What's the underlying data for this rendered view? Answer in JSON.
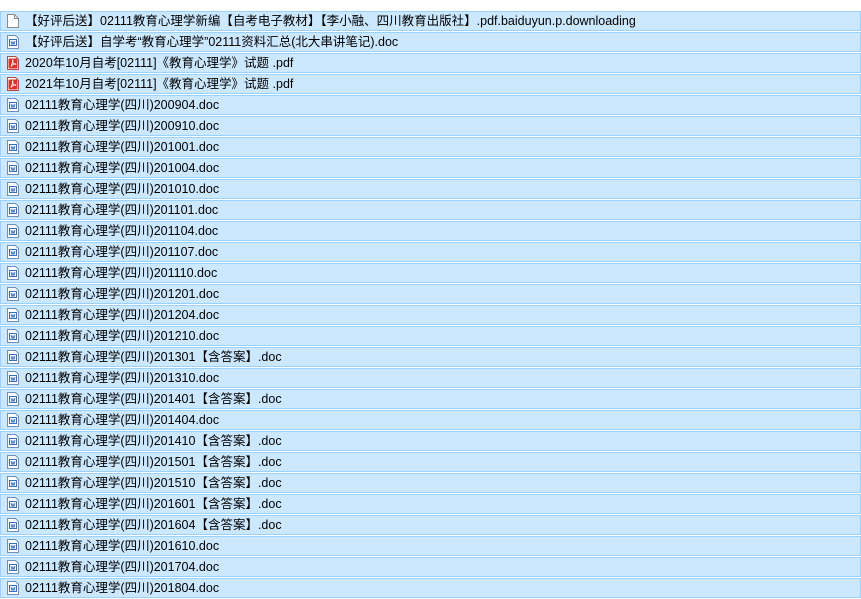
{
  "colors": {
    "selected_background": "#cce8ff",
    "selected_border": "#99d1ff",
    "pdf_icon": "#d9342b",
    "doc_icon": "#3a6fb0"
  },
  "files": [
    {
      "name": "【好评后送】02111教育心理学新编【自考电子教材】【李小融、四川教育出版社】.pdf.baiduyun.p.downloading",
      "icon": "blank-file-icon"
    },
    {
      "name": "【好评后送】自学考“教育心理学”02111资料汇总(北大串讲笔记).doc",
      "icon": "doc-file-icon"
    },
    {
      "name": "2020年10月自考[02111]《教育心理学》试题 .pdf",
      "icon": "pdf-file-icon"
    },
    {
      "name": "2021年10月自考[02111]《教育心理学》试题 .pdf",
      "icon": "pdf-file-icon"
    },
    {
      "name": "02111教育心理学(四川)200904.doc",
      "icon": "doc-file-icon"
    },
    {
      "name": "02111教育心理学(四川)200910.doc",
      "icon": "doc-file-icon"
    },
    {
      "name": "02111教育心理学(四川)201001.doc",
      "icon": "doc-file-icon"
    },
    {
      "name": "02111教育心理学(四川)201004.doc",
      "icon": "doc-file-icon"
    },
    {
      "name": "02111教育心理学(四川)201010.doc",
      "icon": "doc-file-icon"
    },
    {
      "name": "02111教育心理学(四川)201101.doc",
      "icon": "doc-file-icon"
    },
    {
      "name": "02111教育心理学(四川)201104.doc",
      "icon": "doc-file-icon"
    },
    {
      "name": "02111教育心理学(四川)201107.doc",
      "icon": "doc-file-icon"
    },
    {
      "name": "02111教育心理学(四川)201110.doc",
      "icon": "doc-file-icon"
    },
    {
      "name": "02111教育心理学(四川)201201.doc",
      "icon": "doc-file-icon"
    },
    {
      "name": "02111教育心理学(四川)201204.doc",
      "icon": "doc-file-icon"
    },
    {
      "name": "02111教育心理学(四川)201210.doc",
      "icon": "doc-file-icon"
    },
    {
      "name": "02111教育心理学(四川)201301【含答案】.doc",
      "icon": "doc-file-icon"
    },
    {
      "name": "02111教育心理学(四川)201310.doc",
      "icon": "doc-file-icon"
    },
    {
      "name": "02111教育心理学(四川)201401【含答案】.doc",
      "icon": "doc-file-icon"
    },
    {
      "name": "02111教育心理学(四川)201404.doc",
      "icon": "doc-file-icon"
    },
    {
      "name": "02111教育心理学(四川)201410【含答案】.doc",
      "icon": "doc-file-icon"
    },
    {
      "name": "02111教育心理学(四川)201501【含答案】.doc",
      "icon": "doc-file-icon"
    },
    {
      "name": "02111教育心理学(四川)201510【含答案】.doc",
      "icon": "doc-file-icon"
    },
    {
      "name": "02111教育心理学(四川)201601【含答案】.doc",
      "icon": "doc-file-icon"
    },
    {
      "name": "02111教育心理学(四川)201604【含答案】.doc",
      "icon": "doc-file-icon"
    },
    {
      "name": "02111教育心理学(四川)201610.doc",
      "icon": "doc-file-icon"
    },
    {
      "name": "02111教育心理学(四川)201704.doc",
      "icon": "doc-file-icon"
    },
    {
      "name": "02111教育心理学(四川)201804.doc",
      "icon": "doc-file-icon"
    }
  ]
}
